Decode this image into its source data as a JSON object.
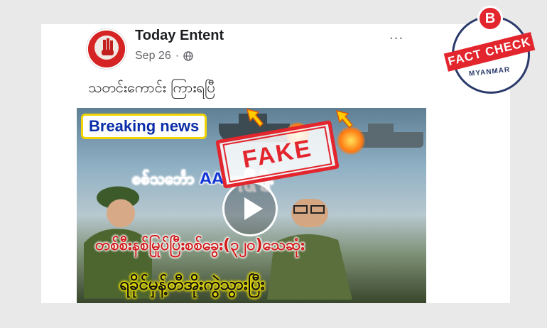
{
  "post": {
    "page_name": "Today Entent",
    "date": "Sep 26",
    "caption": "သတင်းကောင်း ကြားရပြီ",
    "menu_label": "···"
  },
  "video": {
    "breaking_label": "Breaking news",
    "line1": "စစ်သင်္ဘော AA ထုပြိုဖျိုး",
    "line2": "တစ်စီးနစ်မြုပ်ပြီးစစ်ခွေး(၃၂၀)သေဆုံး",
    "line3": "ရခိုင်မှန့်တီအိုးကွဲသွားပြီး",
    "stamp": "FAKE"
  },
  "badge": {
    "logo_letter": "B",
    "ribbon": "FACT CHECK",
    "sub": "MYANMAR"
  },
  "colors": {
    "stamp_red": "#e3262d",
    "badge_navy": "#2a3a6b",
    "breaking_blue": "#0b2ea8"
  },
  "icons": [
    "globe-icon",
    "more-options-icon",
    "play-icon",
    "arrow-icon",
    "explosion-icon"
  ]
}
